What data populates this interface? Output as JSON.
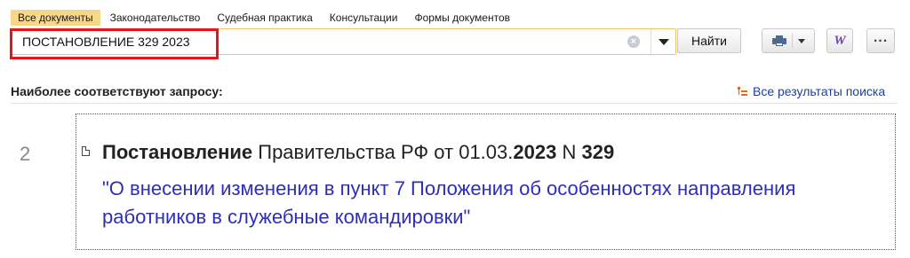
{
  "tabs": [
    {
      "label": "Все документы",
      "active": true
    },
    {
      "label": "Законодательство",
      "active": false
    },
    {
      "label": "Судебная практика",
      "active": false
    },
    {
      "label": "Консультации",
      "active": false
    },
    {
      "label": "Формы документов",
      "active": false
    }
  ],
  "search": {
    "value": "ПОСТАНОВЛЕНИЕ 329 2023",
    "find_label": "Найти",
    "clear_icon": "clear-icon",
    "dropdown_icon": "chevron-down-icon"
  },
  "toolbar": {
    "print_icon": "printer-icon",
    "word_label": "W",
    "more_label": "..."
  },
  "results": {
    "heading": "Наиболее соответствуют запросу:",
    "all_results_label": "Все результаты поиска",
    "items": [
      {
        "number": "2",
        "title_part1": "Постановление",
        "title_part2": " Правительства РФ от 01.03.",
        "title_part3": "2023",
        "title_part4": " N ",
        "title_part5": "329",
        "link_text": "\"О внесении изменения в пункт 7 Положения об особенностях направления работников в служебные командировки\""
      }
    ]
  },
  "colors": {
    "active_tab": "#f7d78a",
    "highlight_frame": "#e8141c",
    "link": "#2e2eb8",
    "accent_orange": "#e36a1a"
  }
}
